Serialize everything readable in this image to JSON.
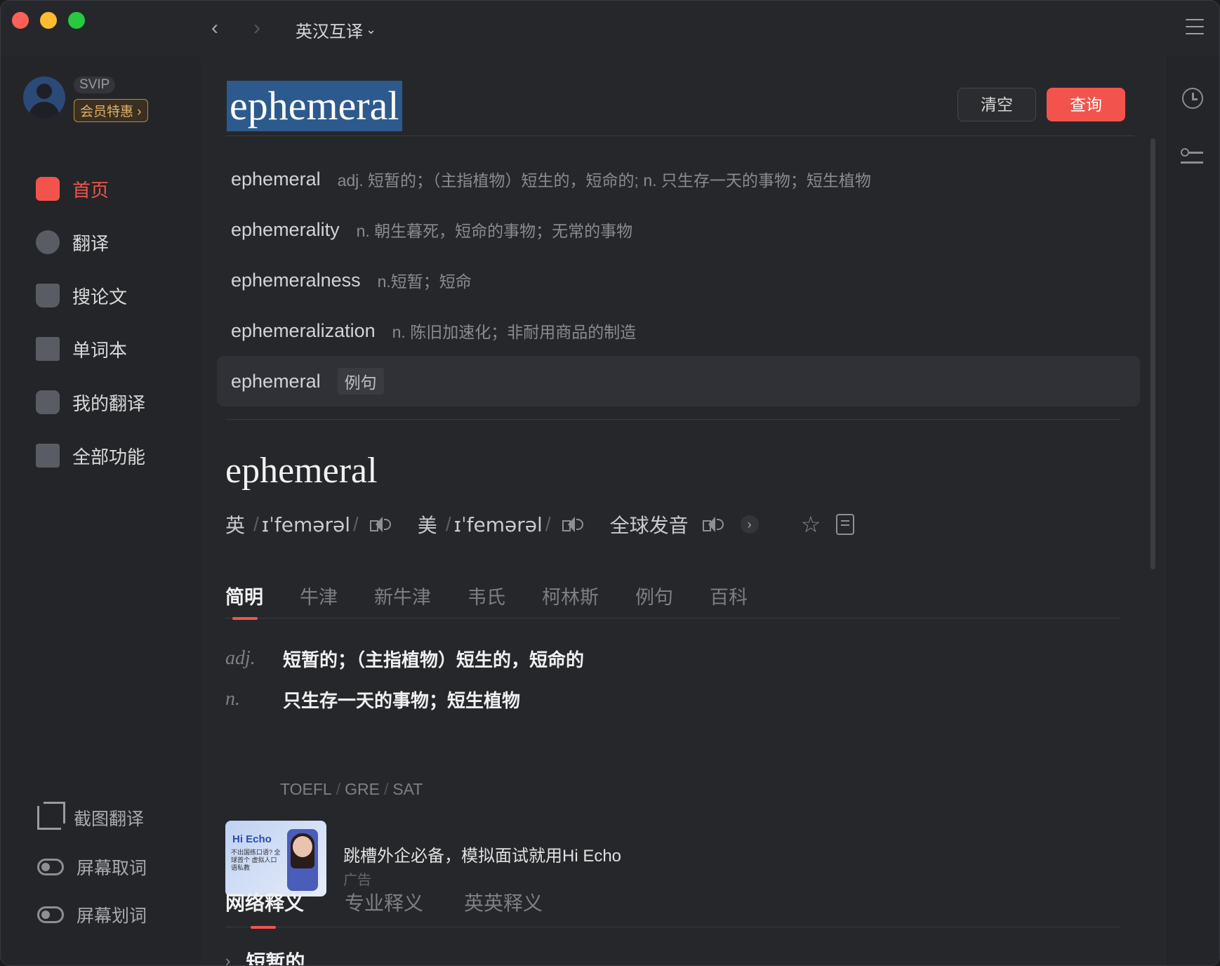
{
  "titlebar": {
    "mode_label": "英汉互译",
    "back_glyph": "‹",
    "forward_glyph": "›",
    "mode_chevron": "⌄"
  },
  "user": {
    "badge": "SVIP",
    "offer": "会员特惠 ›"
  },
  "sidebar": {
    "items": [
      {
        "label": "首页",
        "icon": "home-icon",
        "active": true
      },
      {
        "label": "翻译",
        "icon": "translate-icon"
      },
      {
        "label": "搜论文",
        "icon": "graduation-cap-icon"
      },
      {
        "label": "单词本",
        "icon": "book-icon"
      },
      {
        "label": "我的翻译",
        "icon": "document-icon"
      },
      {
        "label": "全部功能",
        "icon": "grid-icon"
      }
    ],
    "tools": [
      {
        "label": "截图翻译",
        "icon": "crop-icon"
      },
      {
        "label": "屏幕取词",
        "icon": "toggle-icon"
      },
      {
        "label": "屏幕划词",
        "icon": "toggle-icon"
      }
    ]
  },
  "search": {
    "value": "ephemeral",
    "clear_label": "清空",
    "query_label": "查询"
  },
  "suggestions": [
    {
      "word": "ephemeral",
      "def": "adj. 短暂的；（主指植物）短生的，短命的; n. 只生存一天的事物；短生植物"
    },
    {
      "word": "ephemerality",
      "def": "n. 朝生暮死，短命的事物；无常的事物"
    },
    {
      "word": "ephemeralness",
      "def": "n.短暂；短命"
    },
    {
      "word": "ephemeralization",
      "def": "n. 陈旧加速化；非耐用商品的制造"
    },
    {
      "word": "ephemeral",
      "tag": "例句"
    }
  ],
  "entry": {
    "headword": "ephemeral",
    "uk_label": "英",
    "uk_ipa": "ɪˈfemərəl",
    "us_label": "美",
    "us_ipa": "ɪˈfemərəl",
    "global_label": "全球发音",
    "slash": "/",
    "star_glyph": "☆",
    "more_glyph": "›",
    "dict_tabs": [
      "简明",
      "牛津",
      "新牛津",
      "韦氏",
      "柯林斯",
      "例句",
      "百科"
    ],
    "definitions": [
      {
        "pos": "adj.",
        "text": "短暂的；（主指植物）短生的，短命的"
      },
      {
        "pos": "n.",
        "text": "只生存一天的事物；短生植物"
      }
    ],
    "exams": [
      "TOEFL",
      "GRE",
      "SAT"
    ]
  },
  "ad": {
    "title": "跳槽外企必备，模拟面试就用Hi Echo",
    "label": "广告",
    "thumb_title": "Hi Echo",
    "thumb_text": "不出国练口语? 全球首个 虚拟人口语私教"
  },
  "net": {
    "tabs": [
      "网络释义",
      "专业释义",
      "英英释义"
    ],
    "first_item": "短暂的",
    "chevron": "›"
  }
}
